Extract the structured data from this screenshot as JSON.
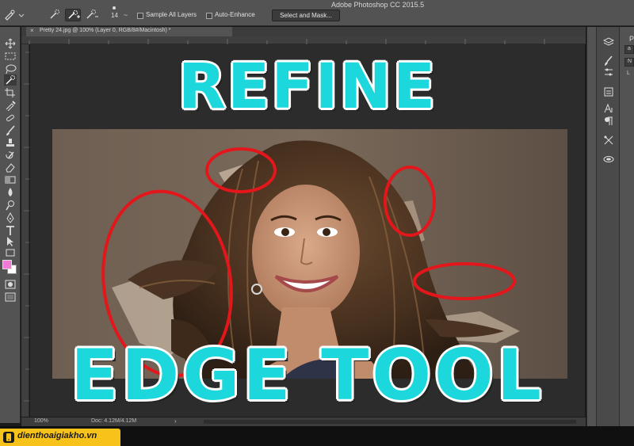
{
  "app": {
    "title": "Adobe Photoshop CC 2015.5"
  },
  "options_bar": {
    "brush_size": "14",
    "size_tilde": "~",
    "sample_all_layers_label": "Sample All Layers",
    "auto_enhance_label": "Auto-Enhance",
    "select_and_mask_label": "Select and Mask..."
  },
  "document": {
    "tab_title": "Pretty 24.jpg @ 100% (Layer 0, RGB/8#/Macintosh) *",
    "tab_close": "×"
  },
  "status_bar": {
    "zoom": "100%",
    "doc_size": "Doc: 4.12M/4.12M",
    "arrow": "›"
  },
  "canvas": {
    "headline_top": "REFINE",
    "headline_bottom": "EDGE TOOL",
    "headline_color": "#1cd8dc",
    "circle_color": "#e3161b"
  },
  "colors": {
    "foreground": "#f07bd6",
    "background": "#ffffff"
  },
  "right_panel": {
    "letter": "P",
    "field_a": "a",
    "field_b": "N",
    "field_c": "L"
  },
  "watermark": {
    "text": "dienthoaigiakho.vn"
  },
  "icons": {
    "toolbar": [
      "move-icon",
      "marquee-icon",
      "lasso-icon",
      "quick-selection-icon",
      "crop-icon",
      "eyedropper-icon",
      "healing-icon",
      "brush-icon",
      "clone-stamp-icon",
      "history-brush-icon",
      "eraser-icon",
      "gradient-icon",
      "blur-icon",
      "dodge-icon",
      "pen-icon",
      "type-icon",
      "path-selection-icon",
      "shape-icon",
      "hand-icon",
      "zoom-icon",
      "more-tools-icon"
    ],
    "panels": [
      "layers-icon",
      "brush-presets-icon",
      "adjustments-icon",
      "character-icon",
      "paragraph-icon",
      "tools-presets-icon",
      "libraries-icon"
    ]
  }
}
